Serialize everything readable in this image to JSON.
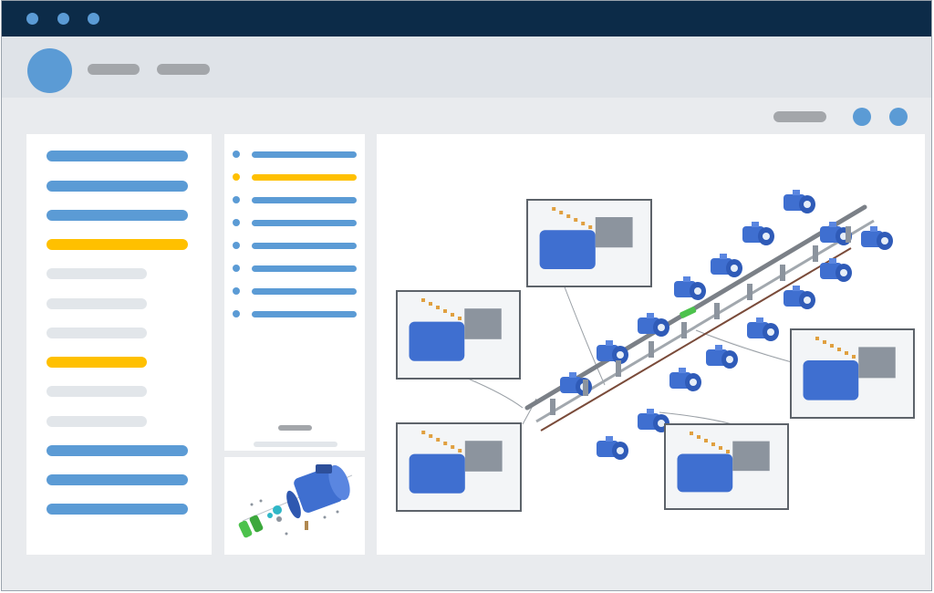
{
  "window": {
    "controls": [
      "dot",
      "dot",
      "dot"
    ],
    "control_color": "#5b9bd5",
    "titlebar_color": "#0c2b48"
  },
  "header": {
    "avatar_color": "#5b9bd5",
    "placeholder_items": 2
  },
  "toolbar": {
    "placeholder_pill": true,
    "icon_buttons": 2
  },
  "sidebar": {
    "items": [
      {
        "state": "blue"
      },
      {
        "state": "blue"
      },
      {
        "state": "blue"
      },
      {
        "state": "yellow"
      },
      {
        "state": "grey"
      },
      {
        "state": "grey"
      },
      {
        "state": "grey"
      },
      {
        "state": "yellow"
      },
      {
        "state": "grey"
      },
      {
        "state": "grey"
      },
      {
        "state": "blue"
      },
      {
        "state": "blue"
      },
      {
        "state": "blue"
      }
    ]
  },
  "list": {
    "items": [
      {
        "state": "blue"
      },
      {
        "state": "yellow"
      },
      {
        "state": "blue"
      },
      {
        "state": "blue"
      },
      {
        "state": "blue"
      },
      {
        "state": "blue"
      },
      {
        "state": "blue"
      },
      {
        "state": "blue"
      }
    ]
  },
  "colors": {
    "accent": "#5b9bd5",
    "highlight": "#ffc000",
    "muted": "#e2e6ea",
    "part_blue": "#3f6fd0",
    "part_grey": "#8c949e",
    "part_green": "#4cc24c"
  },
  "thumbnail": {
    "icon": "exploded-motor-assembly"
  },
  "viewer": {
    "icon": "exploded-manifold-assembly",
    "callouts": 5
  }
}
